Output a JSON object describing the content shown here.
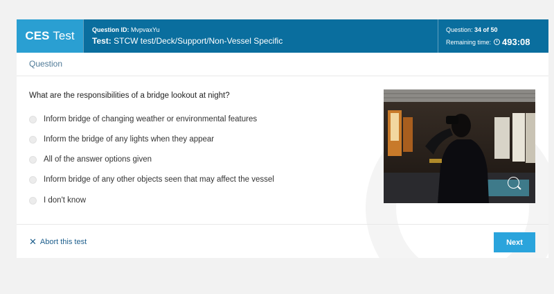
{
  "header": {
    "brand_bold": "CES",
    "brand_light": "Test",
    "question_id_label": "Question ID:",
    "question_id": "MvpvaxYu",
    "test_label": "Test:",
    "test_name": "STCW test/Deck/Support/Non-Vessel Specific",
    "question_label": "Question:",
    "question_progress": "34 of 50",
    "remaining_label": "Remaining time:",
    "remaining_time": "493:08",
    "clock_icon": "clock-icon"
  },
  "section": {
    "title": "Question"
  },
  "question": {
    "text": "What are the responsibilities of a bridge lookout at night?",
    "options": [
      "Inform bridge of changing weather or environmental features",
      "Inform the bridge of any lights when they appear",
      "All of the answer options given",
      "Inform bridge of any other objects seen that may affect the vessel",
      "I don't know"
    ],
    "image_icon": "zoom-icon"
  },
  "footer": {
    "abort_label": "Abort this test",
    "abort_icon": "close-icon",
    "next_label": "Next"
  },
  "colors": {
    "header": "#0a6e9e",
    "brand": "#2a9fd2",
    "next_button": "#2aa4dc",
    "link": "#1d5e8c"
  }
}
